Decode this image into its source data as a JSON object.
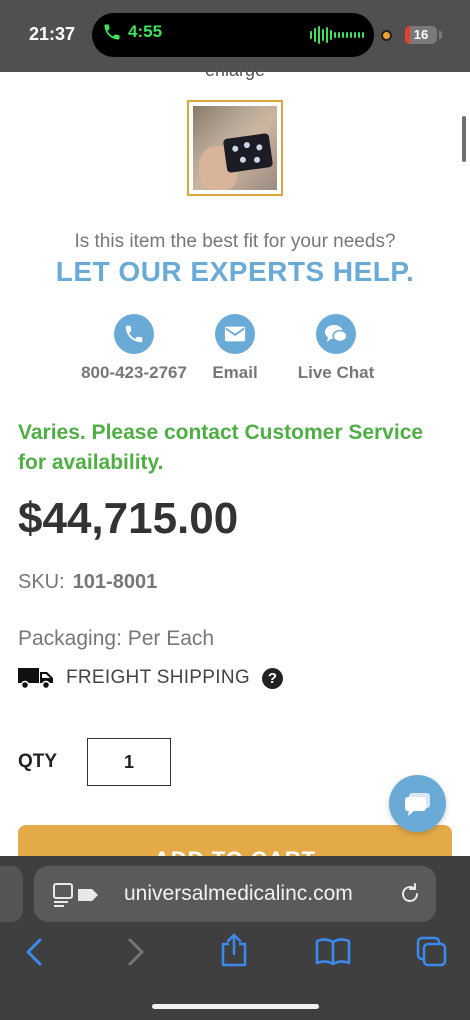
{
  "status_bar": {
    "time": "21:37",
    "call_duration": "4:55",
    "battery_level": "16",
    "battery_fraction": 0.16
  },
  "product": {
    "enlarge_label": "enlarge",
    "fit_question": "Is this item the best fit for your needs?",
    "experts_help": "LET OUR EXPERTS HELP.",
    "contacts": {
      "phone": "800-423-2767",
      "email": "Email",
      "chat": "Live Chat"
    },
    "availability": "Varies. Please contact Customer Service for availability.",
    "price": "$44,715.00",
    "sku_label": "SKU:",
    "sku_value": "101-8001",
    "packaging": "Packaging: Per Each",
    "shipping": "FREIGHT SHIPPING",
    "help_glyph": "?",
    "qty_label": "QTY",
    "qty_value": "1",
    "add_to_cart": "ADD TO CART"
  },
  "browser": {
    "url": "universalmedicalinc.com"
  },
  "colors": {
    "accent_blue": "#6aaad6",
    "availability_green": "#4fae44",
    "cart_orange": "#e4aa48",
    "call_green": "#3ee05c"
  },
  "icons": {
    "phone": "phone-icon",
    "email": "envelope-icon",
    "chat": "chat-bubbles-icon",
    "truck": "truck-icon",
    "help": "question-circle-icon",
    "chat_widget": "chat-widget-icon",
    "cart": "cart-icon",
    "back": "back-chevron-icon",
    "forward": "forward-chevron-icon",
    "share": "share-icon",
    "bookmarks": "book-icon",
    "tabs": "tabs-icon",
    "reader": "reader-mode-icon",
    "reload": "reload-icon"
  }
}
